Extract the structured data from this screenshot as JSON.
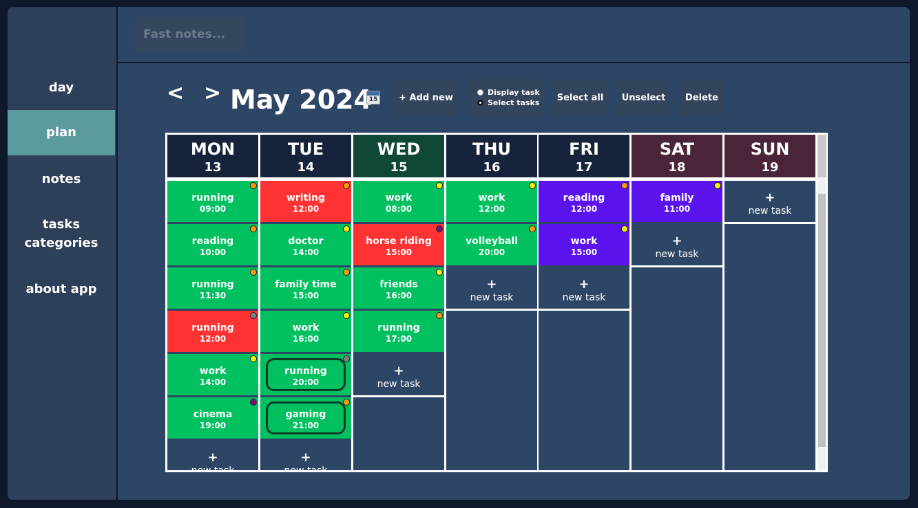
{
  "sidebar": {
    "items": [
      {
        "label": "day",
        "active": false
      },
      {
        "label": "plan",
        "active": true
      },
      {
        "label": "notes",
        "active": false
      },
      {
        "label": "tasks categories",
        "active": false
      },
      {
        "label": "about app",
        "active": false
      }
    ]
  },
  "topbar": {
    "fast_notes_placeholder": "Fast notes..."
  },
  "toolbar": {
    "prev": "<",
    "next": ">",
    "month_title": "May 2024",
    "calendar_icon_num": "15",
    "add_new": "+ Add new",
    "display_task": "Display task",
    "select_tasks": "Select tasks",
    "select_all": "Select all",
    "unselect": "Unselect",
    "delete": "Delete"
  },
  "new_task": {
    "plus": "+",
    "label": "new task"
  },
  "colors": {
    "green": "#00c060",
    "red": "#ff3333",
    "purple": "#5b14ee",
    "header_default": "#15233b",
    "header_wed": "#0f4838",
    "header_weekend": "#4a2438",
    "dot_orange": "#f59a12",
    "dot_yellow": "#f2f20a",
    "dot_gray": "#808080",
    "dot_purple": "#7a1470"
  },
  "days": [
    {
      "name": "MON",
      "num": "13",
      "header": "default",
      "tasks": [
        {
          "name": "running",
          "time": "09:00",
          "color": "green",
          "dot": "orange"
        },
        {
          "name": "reading",
          "time": "10:00",
          "color": "green",
          "dot": "orange"
        },
        {
          "name": "running",
          "time": "11:30",
          "color": "green",
          "dot": "orange"
        },
        {
          "name": "running",
          "time": "12:00",
          "color": "red",
          "dot": "gray"
        },
        {
          "name": "work",
          "time": "14:00",
          "color": "green",
          "dot": "yellow"
        },
        {
          "name": "cinema",
          "time": "19:00",
          "color": "green",
          "dot": "purple"
        }
      ]
    },
    {
      "name": "TUE",
      "num": "14",
      "header": "default",
      "tasks": [
        {
          "name": "writing",
          "time": "12:00",
          "color": "red",
          "dot": "orange"
        },
        {
          "name": "doctor",
          "time": "14:00",
          "color": "green",
          "dot": "yellow"
        },
        {
          "name": "family time",
          "time": "15:00",
          "color": "green",
          "dot": "orange"
        },
        {
          "name": "work",
          "time": "16:00",
          "color": "green",
          "dot": "yellow"
        },
        {
          "name": "running",
          "time": "20:00",
          "color": "green",
          "dot": "gray",
          "selected": true
        },
        {
          "name": "gaming",
          "time": "21:00",
          "color": "green",
          "dot": "orange",
          "selected": true
        }
      ]
    },
    {
      "name": "WED",
      "num": "15",
      "header": "wed",
      "tasks": [
        {
          "name": "work",
          "time": "08:00",
          "color": "green",
          "dot": "yellow"
        },
        {
          "name": "horse riding",
          "time": "15:00",
          "color": "red",
          "dot": "purple"
        },
        {
          "name": "friends",
          "time": "16:00",
          "color": "green",
          "dot": "yellow"
        },
        {
          "name": "running",
          "time": "17:00",
          "color": "green",
          "dot": "orange"
        }
      ]
    },
    {
      "name": "THU",
      "num": "16",
      "header": "default",
      "tasks": [
        {
          "name": "work",
          "time": "12:00",
          "color": "green",
          "dot": "yellow"
        },
        {
          "name": "volleyball",
          "time": "20:00",
          "color": "green",
          "dot": "orange"
        }
      ]
    },
    {
      "name": "FRI",
      "num": "17",
      "header": "default",
      "tasks": [
        {
          "name": "reading",
          "time": "12:00",
          "color": "purple",
          "dot": "orange"
        },
        {
          "name": "work",
          "time": "15:00",
          "color": "purple",
          "dot": "yellow"
        }
      ]
    },
    {
      "name": "SAT",
      "num": "18",
      "header": "weekend",
      "tasks": [
        {
          "name": "family",
          "time": "11:00",
          "color": "purple",
          "dot": "yellow"
        }
      ]
    },
    {
      "name": "SUN",
      "num": "19",
      "header": "weekend",
      "tasks": []
    }
  ]
}
